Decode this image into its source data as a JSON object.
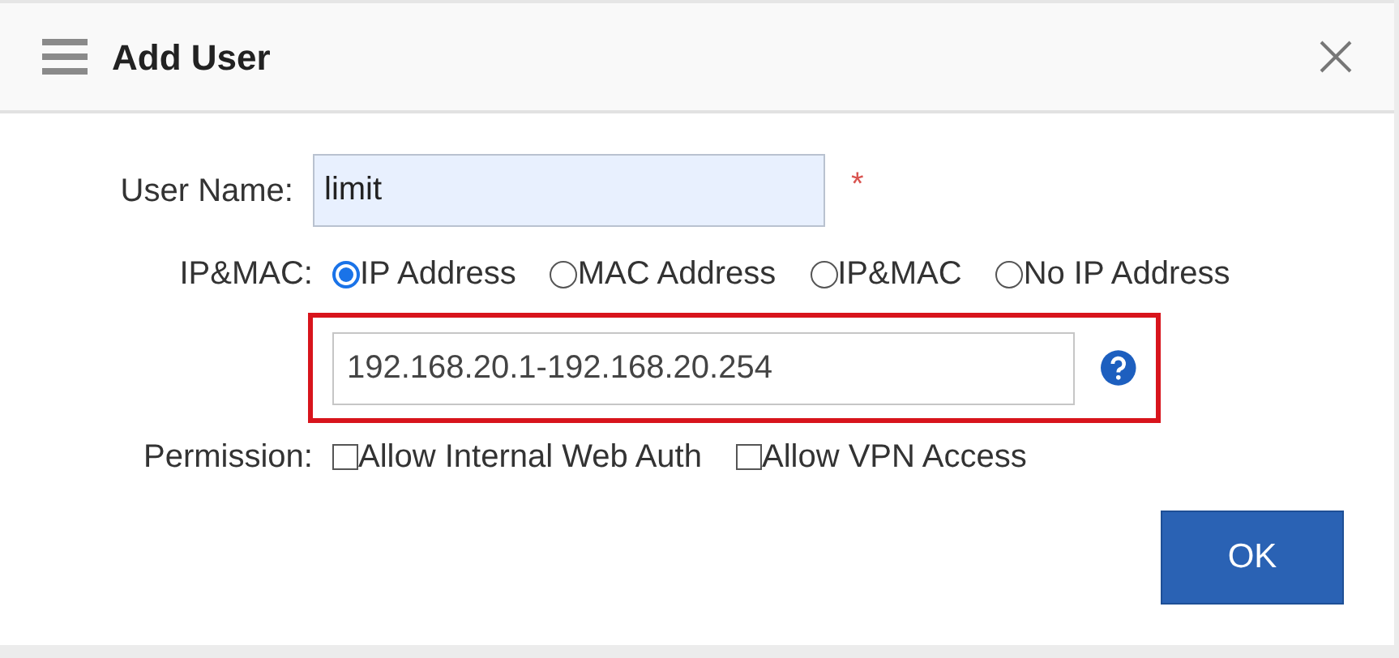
{
  "dialog": {
    "title": "Add User"
  },
  "user_name": {
    "label": "User Name:",
    "value": "limit",
    "required_mark": "*"
  },
  "ip_mac": {
    "label": "IP&MAC:",
    "options": [
      {
        "label": "IP Address",
        "selected": true
      },
      {
        "label": "MAC Address",
        "selected": false
      },
      {
        "label": "IP&MAC",
        "selected": false
      },
      {
        "label": "No IP Address",
        "selected": false
      }
    ],
    "address_value": "192.168.20.1-192.168.20.254",
    "highlighted": true
  },
  "permission": {
    "label": "Permission:",
    "options": [
      {
        "label": "Allow Internal Web Auth",
        "checked": false
      },
      {
        "label": "Allow VPN Access",
        "checked": false
      }
    ]
  },
  "buttons": [
    "OK"
  ]
}
